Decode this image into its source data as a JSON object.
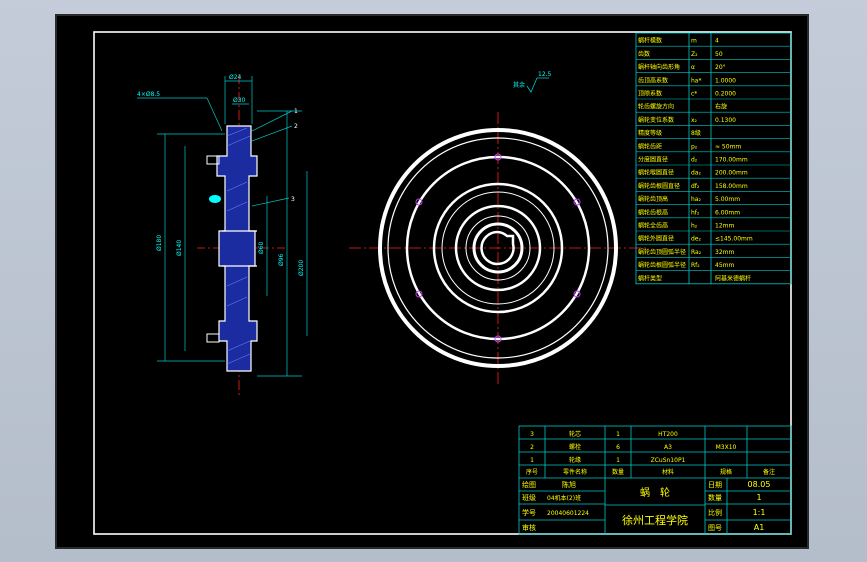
{
  "params": [
    {
      "name": "蜗杆模数",
      "sym": "m",
      "val": "4"
    },
    {
      "name": "齿数",
      "sym": "Z₂",
      "val": "50"
    },
    {
      "name": "蜗杆轴向齿形角",
      "sym": "α",
      "val": "20°"
    },
    {
      "name": "齿顶高系数",
      "sym": "ha*",
      "val": "1.0000"
    },
    {
      "name": "顶隙系数",
      "sym": "c*",
      "val": "0.2000"
    },
    {
      "name": "轮齿螺旋方向",
      "sym": "",
      "val": "右旋"
    },
    {
      "name": "蜗轮变位系数",
      "sym": "x₂",
      "val": "0.1300"
    },
    {
      "name": "精度等级",
      "sym": "8级",
      "val": ""
    },
    {
      "name": "蜗轮齿距",
      "sym": "p₂",
      "val": "≈ 50mm"
    },
    {
      "name": "分度圆直径",
      "sym": "d₂",
      "val": "170.00mm"
    },
    {
      "name": "蜗轮喉圆直径",
      "sym": "da₂",
      "val": "200.00mm"
    },
    {
      "name": "蜗轮齿根圆直径",
      "sym": "df₂",
      "val": "158.00mm"
    },
    {
      "name": "蜗轮齿顶高",
      "sym": "ha₂",
      "val": "5.00mm"
    },
    {
      "name": "蜗轮齿根高",
      "sym": "hf₂",
      "val": "6.00mm"
    },
    {
      "name": "蜗轮全齿高",
      "sym": "h₂",
      "val": "12mm"
    },
    {
      "name": "蜗轮外圆直径",
      "sym": "de₂",
      "val": "≤145.00mm"
    },
    {
      "name": "蜗轮齿顶圆弧半径",
      "sym": "Ra₂",
      "val": "32mm"
    },
    {
      "name": "蜗轮齿根圆弧半径",
      "sym": "Rf₂",
      "val": "45mm"
    },
    {
      "name": "蜗杆类型",
      "sym": "",
      "val": "阿基米德蜗杆"
    }
  ],
  "bom": [
    {
      "no": "3",
      "name": "轮芯",
      "qty": "1",
      "material": "HT200",
      "spec": ""
    },
    {
      "no": "2",
      "name": "螺栓",
      "qty": "6",
      "material": "A3",
      "spec": "M3X10"
    },
    {
      "no": "1",
      "name": "轮缘",
      "qty": "1",
      "material": "ZCuSn10P1",
      "spec": ""
    }
  ],
  "bom_header": {
    "no": "序号",
    "name": "零件名称",
    "qty": "数量",
    "material": "材料",
    "spec": "规格",
    "note": "备注"
  },
  "title": {
    "drawn_label": "绘图",
    "drawn_name": "陈旭",
    "class_label": "班级",
    "class_val": "04机本(2)班",
    "id_label": "学号",
    "id_val": "20040601224",
    "review_label": "审核",
    "part_name": "蜗　轮",
    "school": "徐州工程学院",
    "date_label": "日期",
    "date_val": "08.05",
    "qty_label": "数量",
    "qty_val": "1",
    "scale_label": "比例",
    "scale_val": "1:1",
    "sheet_label": "图号",
    "sheet_val": "A1"
  },
  "roughness": {
    "label": "其余",
    "value": "12.5"
  },
  "section_labels": [
    "1",
    "2",
    "3"
  ],
  "dims": {
    "d1": "Ø180",
    "d2": "Ø200",
    "d3": "Ø140",
    "d4": "4×Ø8.5",
    "d5": "Ø24",
    "d6": "Ø96",
    "d7": "Ø60",
    "d8": "Ø30"
  }
}
